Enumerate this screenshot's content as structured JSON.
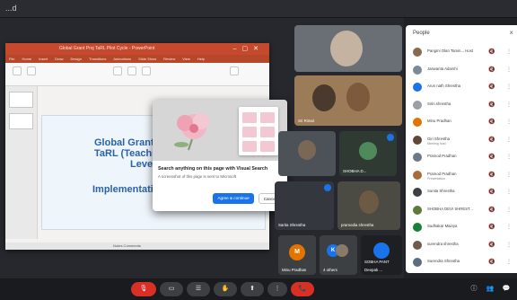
{
  "window": {
    "title": "...d"
  },
  "ppt": {
    "title_bar": "Global Grant Proj TaRL Pilot Cycle - PowerPoint",
    "menu": [
      "File",
      "Home",
      "Insert",
      "Draw",
      "Design",
      "Transitions",
      "Animations",
      "Slide Show",
      "Review",
      "View",
      "Help"
    ],
    "slide": {
      "line1": "Global Grant Pro",
      "line2": "TaRL (Teaching at",
      "line3": "Level)",
      "line4": "Implementation Pl"
    },
    "status": "Notes   Comments"
  },
  "popup": {
    "heading": "Search anything on this page with Visual Search",
    "desc": "A screenshot of this page is sent to Microsoft",
    "agree": "Agree & continue",
    "cancel": "Cancel"
  },
  "tiles": [
    {
      "name": ""
    },
    {
      "name": "Sri Rimal"
    },
    {
      "name": ""
    },
    {
      "name": "SHOBHA D..."
    },
    {
      "name": "Sarita Shrestha"
    },
    {
      "name": "pramodia shrestha"
    },
    {
      "name": "Minu Pradhan"
    },
    {
      "name": "4 others"
    },
    {
      "name": "SOBHA PANT"
    },
    {
      "name": "Deepak ..."
    }
  ],
  "tile_avatars": {
    "minu": "M",
    "others": "K"
  },
  "people": {
    "title": "People",
    "close": "×",
    "rows": [
      {
        "name": "Pangmi Olan Tamin...  Host",
        "sub": "",
        "color": "#8a6a4f"
      },
      {
        "name": "Jaswanta Adarshi",
        "sub": "",
        "color": "#7b8a99"
      },
      {
        "name": "Arun nath Shrestha",
        "sub": "",
        "color": "#1a73e8"
      },
      {
        "name": "Sirin shrestha",
        "sub": "",
        "color": "#9aa0a6"
      },
      {
        "name": "Minu Pradhan",
        "sub": "",
        "color": "#e37400"
      },
      {
        "name": "Giri Shrestha",
        "sub": "Meeting host",
        "color": "#5f4636"
      },
      {
        "name": "Pramod Pradhan",
        "sub": "",
        "color": "#6d7a86"
      },
      {
        "name": "Pramod Pradhan",
        "sub": "Presentation",
        "color": "#a86c3c"
      },
      {
        "name": "Sunita Shrestha",
        "sub": "",
        "color": "#3c4043"
      },
      {
        "name": "SHOBHA DEVI SHREST...",
        "sub": "",
        "color": "#5e7a3a"
      },
      {
        "name": "Sudhakar Mainya",
        "sub": "",
        "color": "#188038"
      },
      {
        "name": "surendra shrestha",
        "sub": "",
        "color": "#6f5b4b"
      },
      {
        "name": "Surendra Shrestha",
        "sub": "",
        "color": "#5b6d7f"
      }
    ]
  },
  "bottom": {
    "leave": "📞",
    "time": "⋮"
  }
}
